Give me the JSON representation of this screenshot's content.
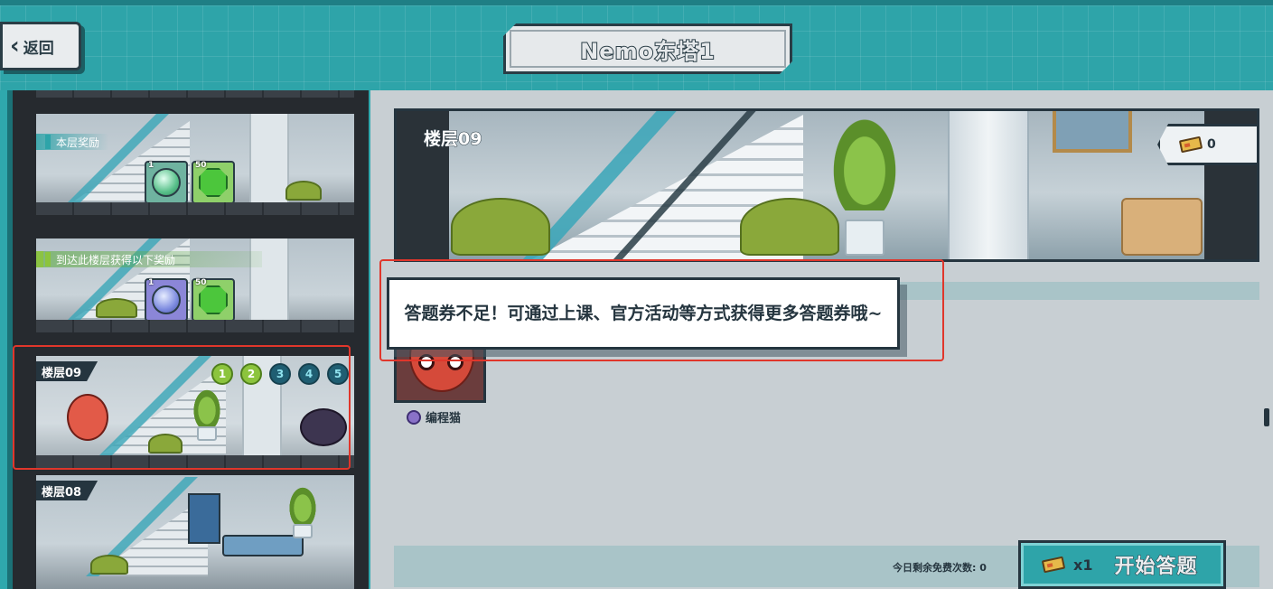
{
  "header": {
    "back_label": "返回",
    "title": "Nemo东塔1"
  },
  "tower": {
    "floor_upper": {
      "reward_label": "本层奖励",
      "rewards": [
        {
          "icon": "orb-helmet-icon",
          "qty": "1"
        },
        {
          "icon": "green-gem-icon",
          "qty": "50"
        }
      ]
    },
    "floor_reach": {
      "reward_label": "到达此楼层获得以下奖励",
      "rewards": [
        {
          "icon": "magnifier-icon",
          "qty": "1"
        },
        {
          "icon": "green-gem-icon",
          "qty": "50"
        }
      ]
    },
    "floor_09": {
      "name": "楼层09",
      "steps": [
        "1",
        "2",
        "3",
        "4",
        "5"
      ],
      "steps_done": 2
    },
    "floor_08": {
      "name": "楼层08"
    }
  },
  "detail": {
    "floor_name": "楼层09",
    "ticket_count": "0",
    "character_name": "编程猫",
    "free_count_text": "今日剩余免费次数: 0",
    "start_cost": "x1",
    "start_label": "开始答题"
  },
  "toast": {
    "message": "答题券不足！可通过上课、官方活动等方式获得更多答题券哦~"
  },
  "colors": {
    "teal": "#2ea4a9",
    "dark": "#25353f",
    "highlight_red": "#e0362b",
    "done_green": "#8cc43d"
  }
}
